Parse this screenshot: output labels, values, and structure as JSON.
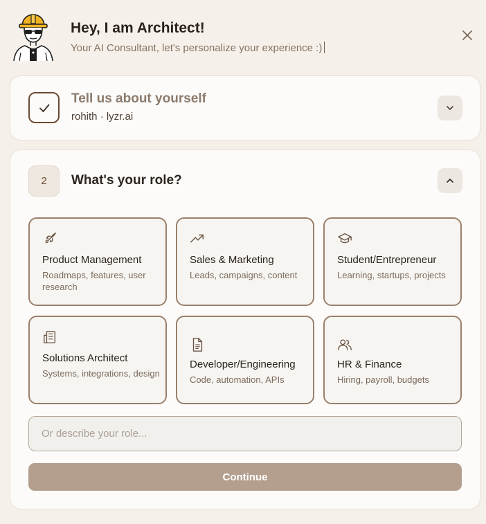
{
  "header": {
    "title": "Hey, I am Architect!",
    "subtitle": "Your AI Consultant, let's personalize your experience :)",
    "avatar_icon": "architect-mascot-icon",
    "close_icon": "close-icon"
  },
  "step1": {
    "title": "Tell us about yourself",
    "summary": "rohith · lyzr.ai",
    "status_icon": "check-icon",
    "toggle_icon": "chevron-down-icon"
  },
  "step2": {
    "number": "2",
    "title": "What's your role?",
    "toggle_icon": "chevron-up-icon",
    "roles": [
      {
        "label": "Product Management",
        "description": "Roadmaps, features, user research",
        "icon": "rocket-icon"
      },
      {
        "label": "Sales & Marketing",
        "description": "Leads, campaigns, content",
        "icon": "trending-up-icon"
      },
      {
        "label": "Student/Entrepreneur",
        "description": "Learning, startups, projects",
        "icon": "graduation-cap-icon"
      },
      {
        "label": "Solutions Architect",
        "description": "Systems, integrations, design",
        "icon": "building-icon"
      },
      {
        "label": "Developer/Engineering",
        "description": "Code, automation, APIs",
        "icon": "document-icon"
      },
      {
        "label": "HR & Finance",
        "description": "Hiring, payroll, budgets",
        "icon": "users-icon"
      }
    ],
    "input_placeholder": "Or describe your role...",
    "input_value": "",
    "continue_label": "Continue"
  },
  "colors": {
    "background": "#f5f1ea",
    "card": "#fcfbf9",
    "accent_border": "#9a806b",
    "continue_button": "#b49f8e",
    "check_border": "#6b4a33"
  }
}
